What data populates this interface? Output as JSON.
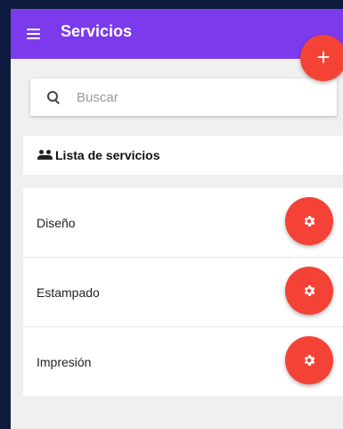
{
  "appbar": {
    "title": "Servicios",
    "menu_icon": "hamburger-menu-icon",
    "add_icon": "plus-icon",
    "add_label": "+"
  },
  "search": {
    "placeholder": "Buscar",
    "value": "",
    "icon": "search-icon"
  },
  "list": {
    "header_icon": "people-icon",
    "header_label": "Lista de servicios",
    "items": [
      {
        "label": "Diseño",
        "action_icon": "gear-icon"
      },
      {
        "label": "Estampado",
        "action_icon": "gear-icon"
      },
      {
        "label": "Impresión",
        "action_icon": "gear-icon"
      }
    ]
  },
  "colors": {
    "appbar": "#7c3aed",
    "fab": "#f44336",
    "background": "#f0f0f0"
  }
}
